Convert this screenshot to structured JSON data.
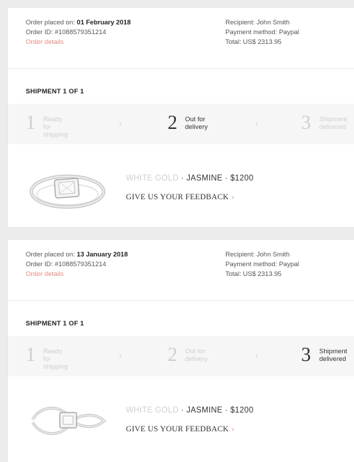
{
  "orders": [
    {
      "placed_label": "Order placed on:",
      "placed_date": "01 February 2018",
      "order_id": "Order ID: #1088579351214",
      "details_link": "Order details",
      "recipient": "Recipient: John Smith",
      "payment": "Payment method: Paypal",
      "total": "Total: US$ 2313.95",
      "shipment_title": "SHIPMENT 1 OF 1",
      "steps": [
        {
          "number": "1",
          "label1": "Ready for",
          "label2": "shipping",
          "active": false
        },
        {
          "number": "2",
          "label1": "Out for",
          "label2": "delivery",
          "active": true
        },
        {
          "number": "3",
          "label1": "Shipment",
          "label2": "delivered",
          "active": false
        }
      ],
      "product": {
        "metal": "WHITE GOLD",
        "name": "JASMINE",
        "price": "$1200"
      },
      "feedback": "GIVE US YOUR FEEDBACK",
      "feedback_arrow": "›"
    },
    {
      "placed_label": "Order placed on:",
      "placed_date": "13 January 2018",
      "order_id": "Order ID: #1088579351214",
      "details_link": "Order details",
      "recipient": "Recipient: John Smith",
      "payment": "Payment method: Paypal",
      "total": "Total: US$ 2313.95",
      "shipment_title": "SHIPMENT 1 OF 1",
      "steps": [
        {
          "number": "1",
          "label1": "Ready for",
          "label2": "shipping",
          "active": false
        },
        {
          "number": "2",
          "label1": "Out for",
          "label2": "delivery",
          "active": false
        },
        {
          "number": "3",
          "label1": "Shipment",
          "label2": "delivered",
          "active": true
        }
      ],
      "product": {
        "metal": "WHITE GOLD",
        "name": "JASMINE",
        "price": "$1200"
      },
      "feedback": "GIVE US YOUR FEEDBACK",
      "feedback_arrow": "›"
    }
  ],
  "separator": "·",
  "chevron": "›",
  "colors": {
    "link": "#e58b83",
    "inactive": "#cfcfd2",
    "tracker_bg": "#f6f6f7"
  }
}
